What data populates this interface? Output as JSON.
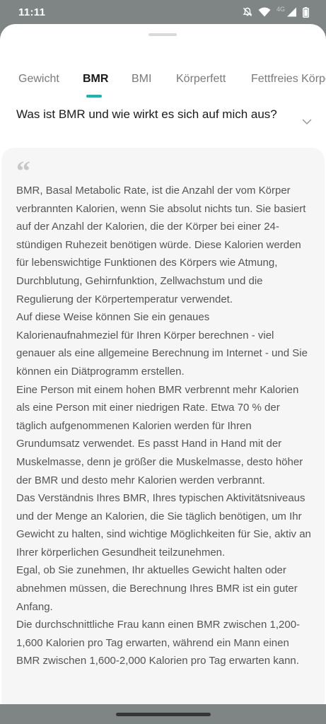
{
  "status_bar": {
    "time": "11:11",
    "network_label": "4G",
    "icons": [
      "do-not-disturb-icon",
      "wifi-icon",
      "signal-icon",
      "battery-icon"
    ]
  },
  "tabs": [
    {
      "label": "Gewicht",
      "active": false
    },
    {
      "label": "BMR",
      "active": true
    },
    {
      "label": "BMI",
      "active": false
    },
    {
      "label": "Körperfett",
      "active": false
    },
    {
      "label": "Fettfreies Körpe",
      "active": false
    }
  ],
  "accent_color": "#15b7b3",
  "question": "Was ist BMR und wie wirkt es sich auf mich aus?",
  "card": {
    "quote_mark": "“",
    "paragraphs": [
      "BMR, Basal Metabolic Rate, ist die Anzahl der vom Körper verbrannten Kalorien, wenn Sie absolut nichts tun. Sie basiert auf der Anzahl der Kalorien, die der Körper bei einer 24-stündigen Ruhezeit benötigen würde. Diese Kalorien werden für lebenswichtige Funktionen des Körpers wie Atmung, Durchblutung, Gehirnfunktion, Zellwachstum und die Regulierung der Körpertemperatur verwendet.",
      "Auf diese Weise können Sie ein genaues Kalorienaufnahmeziel für Ihren Körper berechnen - viel genauer als eine allgemeine Berechnung im Internet - und Sie können ein Diätprogramm erstellen.",
      "Eine Person mit einem hohen BMR verbrennt mehr Kalorien als eine Person mit einer niedrigen Rate. Etwa 70 % der täglich aufgenommenen Kalorien werden für Ihren Grundumsatz verwendet. Es passt Hand in Hand mit der Muskelmasse, denn je größer die Muskelmasse, desto höher der BMR und desto mehr Kalorien werden verbrannt.",
      "Das Verständnis Ihres BMR, Ihres typischen Aktivitätsniveaus und der Menge an Kalorien, die Sie täglich benötigen, um Ihr Gewicht zu halten, sind wichtige Möglichkeiten für Sie, aktiv an Ihrer körperlichen Gesundheit teilzunehmen.",
      "Egal, ob Sie zunehmen, Ihr aktuelles Gewicht halten oder abnehmen müssen, die Berechnung Ihres BMR ist ein guter Anfang.",
      "Die durchschnittliche Frau kann einen BMR zwischen 1,200-1,600 Kalorien pro Tag erwarten, während ein Mann einen BMR zwischen 1,600-2,000 Kalorien pro Tag erwarten kann."
    ]
  }
}
